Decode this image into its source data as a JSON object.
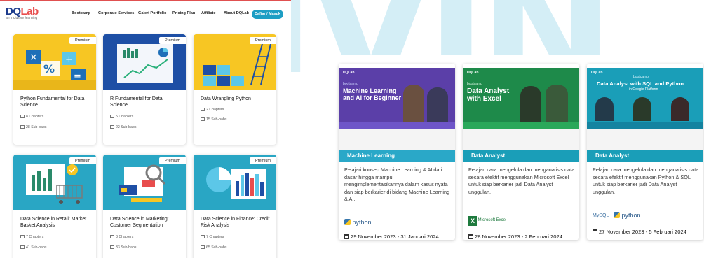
{
  "left_panel": {
    "logo": {
      "brand_a": "DQ",
      "brand_b": "Lab",
      "tagline": "an inclusive learning"
    },
    "nav": {
      "items": [
        "Bootcamp",
        "Corporate Services",
        "Galeri Portfolio",
        "Pricing Plan",
        "Affiliate",
        "About DQLab"
      ],
      "cta": "Daftar / Masuk"
    },
    "courses": [
      {
        "badge": "Premium",
        "title": "Python Fundamental for Data Science",
        "chapters": "8 Chapters",
        "subbab": "28 Sub-babs"
      },
      {
        "badge": "Premium",
        "title": "R Fundamental for Data Science",
        "chapters": "5 Chapters",
        "subbab": "22 Sub-babs"
      },
      {
        "badge": "Premium",
        "title": "Data Wrangling Python",
        "chapters": "2 Chapters",
        "subbab": "15 Sub-babs"
      },
      {
        "badge": "Premium",
        "title": "Data Science in Retail: Market Basket Analysis",
        "chapters": "7 Chapters",
        "subbab": "41 Sub-babs"
      },
      {
        "badge": "Premium",
        "title": "Data Science in Marketing: Customer Segmentation",
        "chapters": "8 Chapters",
        "subbab": "33 Sub-babs"
      },
      {
        "badge": "Premium",
        "title": "Data Science in Finance: Credit Risk Analysis",
        "chapters": "7 Chapters",
        "subbab": "65 Sub-babs"
      }
    ]
  },
  "right_panel": {
    "bootcamps": [
      {
        "banner_brand": "DQLab",
        "banner_kicker": "bootcamp",
        "banner_title_1": "Machine Learning",
        "banner_title_2": "and AI for Beginner",
        "category": "Machine Learning",
        "description": "Pelajari konsep Machine Learning & AI dari dasar hingga mampu mengimplementasikannya dalam kasus nyata dan siap berkarier di bidang Machine Learning & AI.",
        "tool_1": "python",
        "tool_2": "",
        "date": "29 November 2023 - 31 Januari 2024"
      },
      {
        "banner_brand": "DQLab",
        "banner_kicker": "bootcamp",
        "banner_title_1": "Data Analyst",
        "banner_title_2": "with Excel",
        "category": "Data Analyst",
        "description": "Pelajari cara mengelola dan menganalisis data secara efektif menggunakan Microsoft Excel untuk siap berkarier jadi Data Analyst unggulan.",
        "tool_1": "Microsoft Excel",
        "tool_2": "",
        "date": "28 November 2023 - 2 Februari 2024"
      },
      {
        "banner_brand": "DQLab",
        "banner_kicker": "bootcamp",
        "banner_title_1": "Data Analyst with SQL and Python",
        "banner_title_2": "in Google Platform",
        "category": "Data Analyst",
        "description": "Pelajari cara mengelola dan menganalisis data secara efektif menggunakan Python & SQL untuk siap berkarier jadi Data Analyst unggulan.",
        "tool_1": "MySQL",
        "tool_2": "python",
        "date": "27 November 2023 - 5 Februari 2024"
      }
    ]
  },
  "colors": {
    "watermark": "#d4eef6",
    "nav_cta": "#1d9ec4",
    "ml_banner": "#5b3fa8",
    "ml_category": "#2aa8c8",
    "excel_banner": "#1e8a4a",
    "sql_banner": "#1a9eb8",
    "category_bar": "#1a9eb8"
  }
}
